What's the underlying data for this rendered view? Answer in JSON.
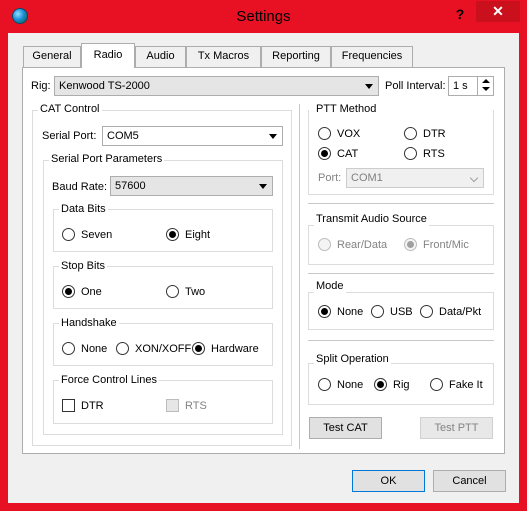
{
  "window": {
    "title": "Settings",
    "help_label": "?",
    "close_label": "✕"
  },
  "tabs": [
    {
      "label": "General"
    },
    {
      "label": "Radio"
    },
    {
      "label": "Audio"
    },
    {
      "label": "Tx Macros"
    },
    {
      "label": "Reporting"
    },
    {
      "label": "Frequencies"
    }
  ],
  "active_tab": "Radio",
  "rig": {
    "label": "Rig:",
    "value": "Kenwood TS-2000"
  },
  "poll": {
    "label": "Poll Interval:",
    "value": "1 s"
  },
  "cat": {
    "title": "CAT Control",
    "serial_port": {
      "label": "Serial Port:",
      "value": "COM5"
    },
    "params_title": "Serial Port Parameters",
    "baud": {
      "label": "Baud Rate:",
      "value": "57600"
    },
    "data_bits": {
      "title": "Data Bits",
      "options": [
        "Seven",
        "Eight"
      ],
      "selected": "Eight"
    },
    "stop_bits": {
      "title": "Stop Bits",
      "options": [
        "One",
        "Two"
      ],
      "selected": "One"
    },
    "handshake": {
      "title": "Handshake",
      "options": [
        "None",
        "XON/XOFF",
        "Hardware"
      ],
      "selected": "Hardware"
    },
    "force": {
      "title": "Force Control Lines",
      "dtr": "DTR",
      "rts": "RTS"
    }
  },
  "ptt": {
    "title": "PTT Method",
    "options": [
      "VOX",
      "DTR",
      "CAT",
      "RTS"
    ],
    "selected": "CAT",
    "port_label": "Port:",
    "port_value": "COM1"
  },
  "tx_audio": {
    "title": "Transmit Audio Source",
    "options": [
      "Rear/Data",
      "Front/Mic"
    ],
    "selected": "Front/Mic"
  },
  "mode": {
    "title": "Mode",
    "options": [
      "None",
      "USB",
      "Data/Pkt"
    ],
    "selected": "None"
  },
  "split": {
    "title": "Split Operation",
    "options": [
      "None",
      "Rig",
      "Fake It"
    ],
    "selected": "Rig"
  },
  "buttons": {
    "test_cat": "Test CAT",
    "test_ptt": "Test PTT",
    "ok": "OK",
    "cancel": "Cancel"
  }
}
